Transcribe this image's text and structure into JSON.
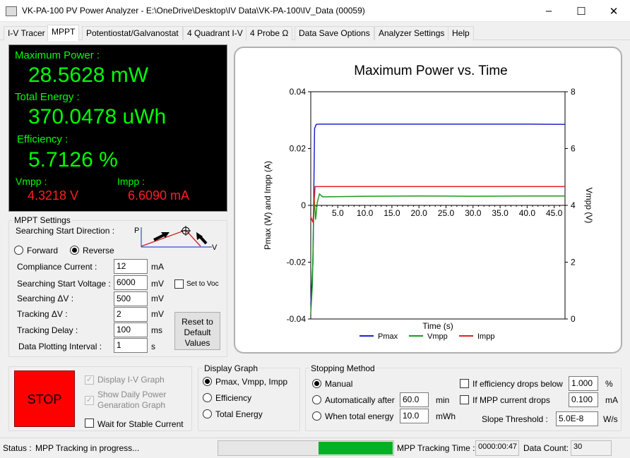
{
  "window": {
    "title": "VK-PA-100 PV Power Analyzer - E:\\OneDrive\\Desktop\\IV Data\\VK-PA-100\\IV_Data (00059)",
    "minimize": "–",
    "maximize": "☐",
    "close": "✕"
  },
  "tabs": [
    "I-V Tracer",
    "MPPT",
    "Potentiostat/Galvanostat",
    "4 Quadrant I-V",
    "4 Probe Ω",
    "Data Save Options",
    "Analyzer Settings",
    "Help"
  ],
  "meter": {
    "max_power_label": "Maximum Power :",
    "max_power_value": "28.5628 mW",
    "total_energy_label": "Total Energy :",
    "total_energy_value": "370.0478 uWh",
    "efficiency_label": "Efficiency :",
    "efficiency_value": "5.7126 %",
    "vmpp_label": "Vmpp :",
    "vmpp_value": "4.3218 V",
    "impp_label": "Impp :",
    "impp_value": "6.6090 mA"
  },
  "mppt": {
    "group_title": "MPPT Settings",
    "direction_label": "Searching Start Direction :",
    "forward_label": "Forward",
    "reverse_label": "Reverse",
    "direction_selected": "Reverse",
    "diagram_p": "P",
    "diagram_v": "V",
    "compliance_label": "Compliance Current :",
    "compliance_value": "12",
    "compliance_unit": "mA",
    "start_voltage_label": "Searching Start Voltage :",
    "start_voltage_value": "6000",
    "start_voltage_unit": "mV",
    "set_to_voc_label": "Set to Voc",
    "searching_dv_label": "Searching ΔV :",
    "searching_dv_value": "500",
    "searching_dv_unit": "mV",
    "tracking_dv_label": "Tracking ΔV :",
    "tracking_dv_value": "2",
    "tracking_dv_unit": "mV",
    "tracking_delay_label": "Tracking Delay :",
    "tracking_delay_value": "100",
    "tracking_delay_unit": "ms",
    "plot_interval_label": "Data Plotting Interval :",
    "plot_interval_value": "1",
    "plot_interval_unit": "s",
    "reset_label": "Reset to Default Values"
  },
  "controls": {
    "stop_label": "STOP",
    "display_iv_label": "Display I-V Graph",
    "show_daily_label": "Show Daily Power Genaration Graph",
    "wait_stable_label": "Wait for Stable Current"
  },
  "display_graph": {
    "title": "Display Graph",
    "options": [
      "Pmax, Vmpp, Impp",
      "Efficiency",
      "Total Energy"
    ],
    "selected": "Pmax, Vmpp, Impp"
  },
  "stopping": {
    "title": "Stopping Method",
    "manual_label": "Manual",
    "auto_label": "Automatically after",
    "auto_value": "60.0",
    "auto_unit": "min",
    "energy_label": "When total energy",
    "energy_value": "10.0",
    "energy_unit": "mWh",
    "eff_label": "If efficiency drops below",
    "eff_value": "1.000",
    "eff_unit": "%",
    "mpp_label": "If MPP current drops",
    "mpp_value": "0.100",
    "mpp_unit": "mA",
    "slope_label": "Slope Threshold :",
    "slope_value": "5.0E-8",
    "slope_unit": "W/s",
    "selected": "Manual"
  },
  "statusbar": {
    "status_label": "Status :",
    "status_text": "MPP Tracking in progress...",
    "progress": 0.43,
    "tracking_time_label": "MPP Tracking Time :",
    "tracking_time_value": "0000:00:47",
    "data_count_label": "Data Count:",
    "data_count_value": "30"
  },
  "chart_data": {
    "type": "line",
    "title": "Maximum Power vs. Time",
    "xlabel": "Time (s)",
    "ylabel": "Pmax (W) and Impp (A)",
    "y2label": "Vmpp (V)",
    "xlim": [
      0,
      47
    ],
    "ylim": [
      -0.04,
      0.04
    ],
    "y2lim": [
      0,
      8
    ],
    "x_ticks": [
      "5.0",
      "10.0",
      "15.0",
      "20.0",
      "25.0",
      "30.0",
      "35.0",
      "40.0",
      "45.0"
    ],
    "y_ticks": [
      "-0.04",
      "-0.02",
      "0",
      "0.02",
      "0.04"
    ],
    "y2_ticks": [
      "0",
      "2",
      "4",
      "6",
      "8"
    ],
    "legend_position": "bottom",
    "grid": false,
    "series": [
      {
        "name": "Pmax",
        "color": "#1f24c8",
        "axis": "left",
        "x": [
          0,
          0.4,
          0.7,
          1,
          1.5,
          3,
          10,
          20,
          30,
          40,
          47
        ],
        "y": [
          -0.035,
          -0.02,
          0.027,
          0.0285,
          0.0286,
          0.0286,
          0.0286,
          0.0286,
          0.0286,
          0.0286,
          0.0285
        ]
      },
      {
        "name": "Vmpp",
        "color": "#1a9a1a",
        "axis": "right",
        "x": [
          0,
          0.3,
          0.6,
          0.9,
          1.2,
          1.6,
          2.2,
          3,
          10,
          20,
          30,
          40,
          47
        ],
        "y": [
          0.2,
          1.2,
          4.3,
          3.5,
          4.1,
          4.4,
          4.3,
          4.3,
          4.32,
          4.33,
          4.32,
          4.33,
          4.33
        ]
      },
      {
        "name": "Impp",
        "color": "#e02020",
        "axis": "left",
        "x": [
          0,
          0.4,
          0.8,
          1.2,
          2,
          5,
          10,
          20,
          30,
          40,
          47
        ],
        "y": [
          -0.004,
          -0.006,
          0.0066,
          0.0066,
          0.0066,
          0.0066,
          0.0066,
          0.0066,
          0.0066,
          0.0066,
          0.0066
        ]
      }
    ]
  }
}
